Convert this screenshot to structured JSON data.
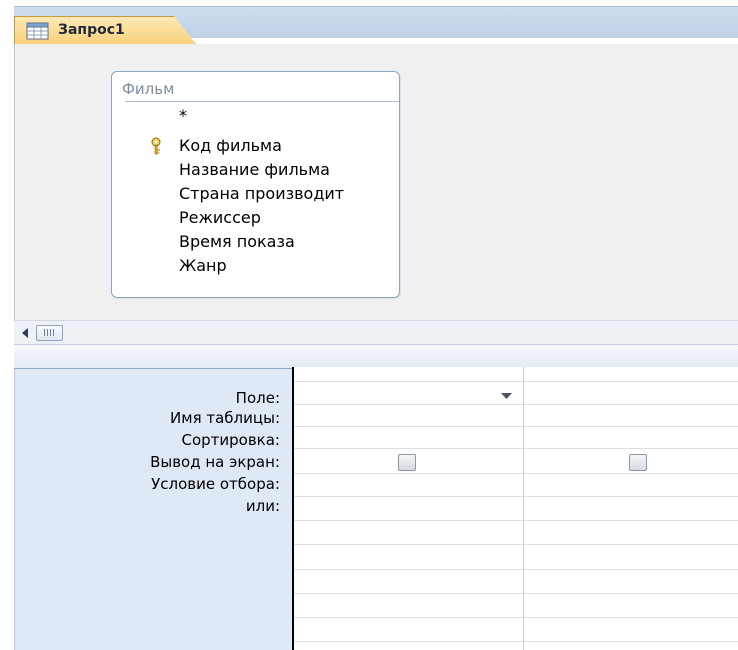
{
  "tab": {
    "label": "Запрос1",
    "icon": "query-icon"
  },
  "design": {
    "table": {
      "title": "Фильм",
      "fields": [
        {
          "label": "*",
          "is_key": false
        },
        {
          "label": "Код фильма",
          "is_key": true
        },
        {
          "label": "Название фильма",
          "is_key": false
        },
        {
          "label": "Страна производит",
          "is_key": false
        },
        {
          "label": "Режиссер",
          "is_key": false
        },
        {
          "label": "Время показа",
          "is_key": false
        },
        {
          "label": "Жанр",
          "is_key": false
        }
      ]
    },
    "key_icon": "primary-key-icon"
  },
  "scrollbar": {
    "left_arrow_icon": "scroll-left-arrow-icon",
    "thumb_icon": "scroll-thumb-grip-icon"
  },
  "grid": {
    "row_labels": [
      "Поле:",
      "Имя таблицы:",
      "Сортировка:",
      "Вывод на экран:",
      "Условие отбора:",
      "или:"
    ],
    "columns": [
      {
        "field": "",
        "table": "",
        "sort": "",
        "show": false,
        "criteria": "",
        "or": ""
      },
      {
        "field": "",
        "table": "",
        "sort": "",
        "show": false,
        "criteria": "",
        "or": ""
      }
    ],
    "dropdown_icon": "dropdown-arrow-icon"
  },
  "colors": {
    "tab_active": "#f9d27c",
    "tab_strip": "#c1d2e8",
    "design_background": "#f0f0f0",
    "grid_label_background": "#dfe8f5",
    "table_border": "#8ea6c4"
  }
}
